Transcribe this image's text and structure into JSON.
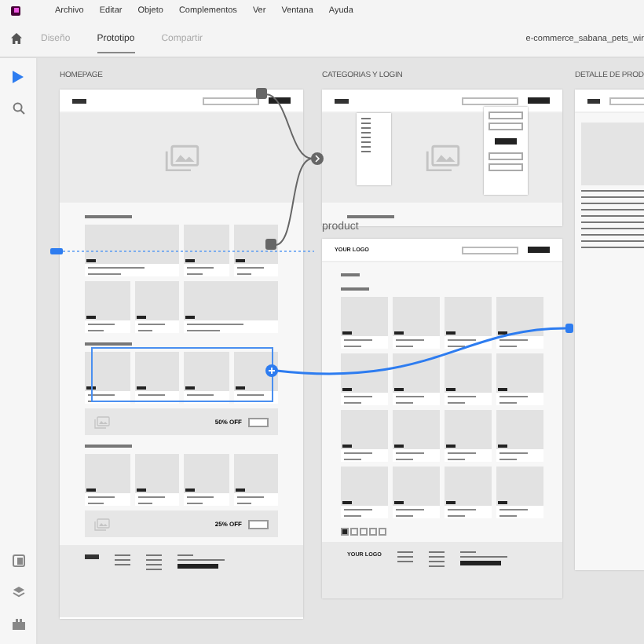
{
  "menu": [
    "Archivo",
    "Editar",
    "Objeto",
    "Complementos",
    "Ver",
    "Ventana",
    "Ayuda"
  ],
  "tabs": [
    {
      "label": "Diseño",
      "selected": false
    },
    {
      "label": "Prototipo",
      "selected": true
    },
    {
      "label": "Compartir",
      "selected": false
    }
  ],
  "document_title": "e-commerce_sabana_pets_wir",
  "tools": [
    {
      "kind": "select",
      "selected": true
    },
    {
      "kind": "zoom",
      "selected": false
    }
  ],
  "panel_tools": [
    {
      "kind": "assets"
    },
    {
      "kind": "layers"
    },
    {
      "kind": "plugins"
    }
  ],
  "artboards": [
    {
      "title": "HOMEPAGE",
      "kind": "homepage",
      "promos": [
        "50% OFF",
        "25% OFF"
      ]
    },
    {
      "title": "CATEGORIAS Y LOGIN",
      "kind": "categories"
    },
    {
      "title": "product",
      "kind": "catalog",
      "logo": "YOUR LOGO",
      "footer_logo": "YOUR LOGO"
    },
    {
      "title": "DETALLE DE PROD",
      "kind": "detail"
    }
  ]
}
